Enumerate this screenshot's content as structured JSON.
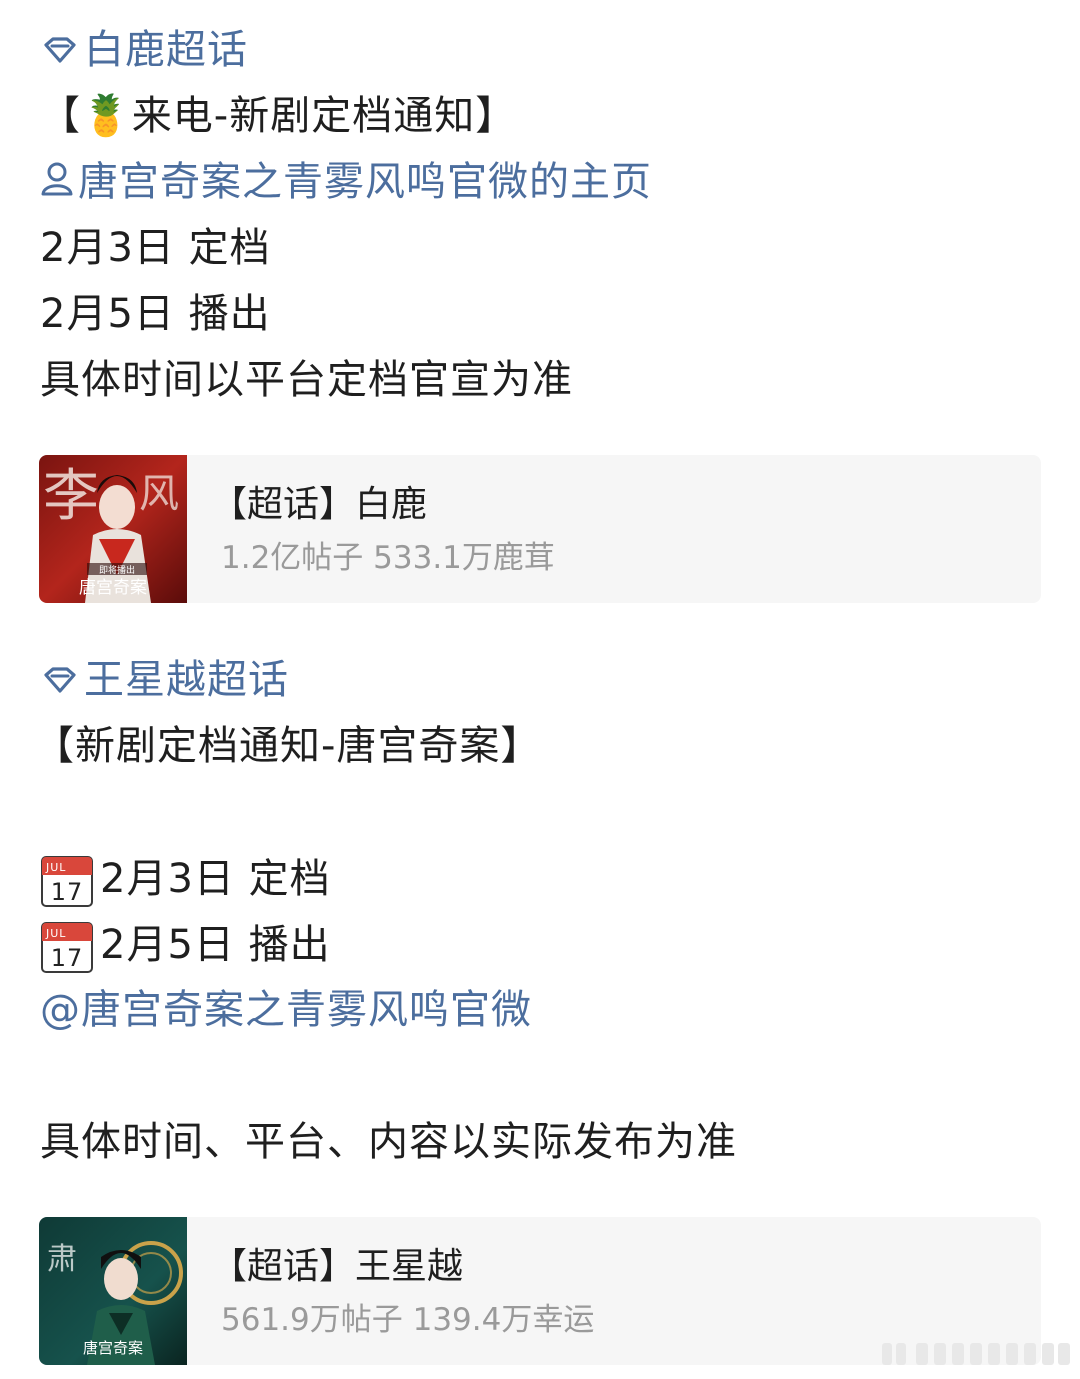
{
  "posts": [
    {
      "supertopic": "白鹿超话",
      "heading": "【🍍来电-新剧定档通知】",
      "profile_link": "唐宫奇案之青雾风鸣官微的主页",
      "lines": [
        "2月3日 定档",
        "2月5日 播出",
        "具体时间以平台定档官宣为准"
      ],
      "card": {
        "title": "【超话】白鹿",
        "stats": "1.2亿帖子 533.1万鹿茸",
        "thumb_text_top": "即将播出",
        "thumb_text_main": "唐宫奇案"
      }
    },
    {
      "supertopic": "王星越超话",
      "heading": "【新剧定档通知-唐宫奇案】",
      "cal_month": "JUL",
      "cal_day": "17",
      "lines": [
        "2月3日 定档",
        "2月5日 播出"
      ],
      "mention": "@唐宫奇案之青雾风鸣官微",
      "footer": "具体时间、平台、内容以实际发布为准",
      "card": {
        "title": "【超话】王星越",
        "stats": "561.9万帖子 139.4万幸运",
        "thumb_text_main": "唐宫奇案"
      }
    }
  ],
  "colors": {
    "link": "#4c6e9e",
    "text": "#1f1f1f",
    "muted": "#9a9a9a",
    "card_bg": "#f6f6f6"
  }
}
